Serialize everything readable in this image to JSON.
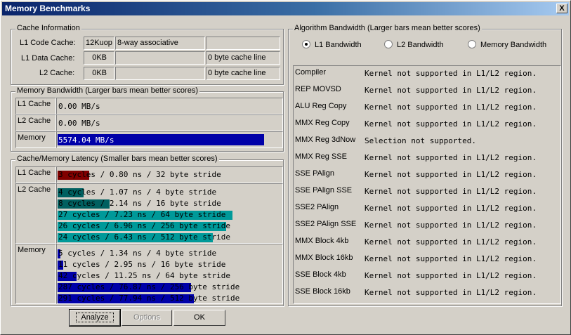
{
  "window": {
    "title": "Memory Benchmarks",
    "close_label": "X"
  },
  "cache_info": {
    "title": "Cache Information",
    "rows": [
      {
        "label": "L1 Code Cache:",
        "size": "12Kuop",
        "assoc": "8-way associative",
        "line": ""
      },
      {
        "label": "L1 Data Cache:",
        "size": "0KB",
        "assoc": "",
        "line": "0 byte cache line"
      },
      {
        "label": "L2 Cache:",
        "size": "0KB",
        "assoc": "",
        "line": "0 byte cache line"
      }
    ]
  },
  "mem_bandwidth": {
    "title": "Memory Bandwidth (Larger bars mean better scores)",
    "rows": [
      {
        "label": "L1 Cache",
        "value": "0.00 MB/s",
        "fill": 0.0
      },
      {
        "label": "L2 Cache",
        "value": "0.00 MB/s",
        "fill": 0.0
      },
      {
        "label": "Memory",
        "value": "5574.04 MB/s",
        "fill": 1.0
      }
    ],
    "bar_color": "#0000a8"
  },
  "latency": {
    "title": "Cache/Memory Latency (Smaller bars mean better scores)",
    "groups": [
      {
        "label": "L1 Cache",
        "color": "#800000",
        "rows": [
          {
            "text": "3 cycles / 0.80 ns / 32 byte stride",
            "fill": 0.23
          }
        ]
      },
      {
        "label": "L2 Cache",
        "color_low": "#006060",
        "color": "#009999",
        "rows": [
          {
            "text": "4 cycles / 1.07 ns / 4 byte stride",
            "fill": 0.12
          },
          {
            "text": "8 cycles / 2.14 ns / 16 byte stride",
            "fill": 0.24
          },
          {
            "text": "27 cycles / 7.23 ns / 64 byte stride",
            "fill": 0.81
          },
          {
            "text": "26 cycles / 6.96 ns / 256 byte stride",
            "fill": 0.78
          },
          {
            "text": "24 cycles / 6.43 ns / 512 byte stride",
            "fill": 0.72
          }
        ]
      },
      {
        "label": "Memory",
        "color": "#0000a8",
        "rows": [
          {
            "text": "5 cycles / 1.34 ns / 4 byte stride",
            "fill": 0.02
          },
          {
            "text": "11 cycles / 2.95 ns / 16 byte stride",
            "fill": 0.04
          },
          {
            "text": "42 cycles / 11.25 ns / 64 byte stride",
            "fill": 0.14
          },
          {
            "text": "287 cycles / 76.87 ns / 256 byte stride",
            "fill": 0.98
          },
          {
            "text": "291 cycles / 77.94 ns / 512 byte stride",
            "fill": 1.0
          }
        ]
      }
    ]
  },
  "algorithm": {
    "title": "Algorithm Bandwidth (Larger bars mean better scores)",
    "options": [
      {
        "label": "L1 Bandwidth",
        "selected": true
      },
      {
        "label": "L2 Bandwidth",
        "selected": false
      },
      {
        "label": "Memory Bandwidth",
        "selected": false
      }
    ],
    "rows": [
      {
        "name": "Compiler",
        "result": "Kernel not supported in L1/L2 region."
      },
      {
        "name": "REP MOVSD",
        "result": "Kernel not supported in L1/L2 region."
      },
      {
        "name": "ALU Reg Copy",
        "result": "Kernel not supported in L1/L2 region."
      },
      {
        "name": "MMX Reg Copy",
        "result": "Kernel not supported in L1/L2 region."
      },
      {
        "name": "MMX Reg 3dNow",
        "result": "Selection not supported."
      },
      {
        "name": "MMX Reg SSE",
        "result": "Kernel not supported in L1/L2 region."
      },
      {
        "name": "SSE PAlign",
        "result": "Kernel not supported in L1/L2 region."
      },
      {
        "name": "SSE PAlign SSE",
        "result": "Kernel not supported in L1/L2 region."
      },
      {
        "name": "SSE2 PAlign",
        "result": "Kernel not supported in L1/L2 region."
      },
      {
        "name": "SSE2 PAlign SSE",
        "result": "Kernel not supported in L1/L2 region."
      },
      {
        "name": "MMX Block 4kb",
        "result": "Kernel not supported in L1/L2 region."
      },
      {
        "name": "MMX Block 16kb",
        "result": "Kernel not supported in L1/L2 region."
      },
      {
        "name": "SSE Block 4kb",
        "result": "Kernel not supported in L1/L2 region."
      },
      {
        "name": "SSE Block 16kb",
        "result": "Kernel not supported in L1/L2 region."
      }
    ]
  },
  "buttons": {
    "analyze": "Analyze",
    "options": "Options",
    "ok": "OK"
  }
}
